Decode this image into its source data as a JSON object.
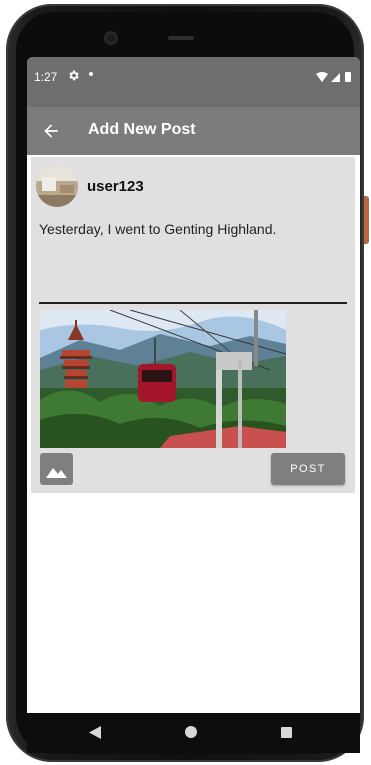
{
  "status_bar": {
    "time": "1:27",
    "icons": [
      "settings-icon",
      "notification-dot-icon",
      "wifi-icon",
      "signal-icon",
      "battery-icon"
    ]
  },
  "app_bar": {
    "title": "Add New Post",
    "back_icon": "arrow-left-icon"
  },
  "post": {
    "username": "user123",
    "text": "Yesterday, I went to Genting Highland.",
    "image_icon": "image-icon",
    "submit_label": "POST"
  },
  "nav_bar": {
    "icons": [
      "back-triangle-icon",
      "home-circle-icon",
      "recents-square-icon"
    ]
  },
  "colors": {
    "status_bar": "#6e6e6e",
    "app_bar": "#7c7c7c",
    "card": "#e0e0e0",
    "button": "#7f7f7f"
  }
}
